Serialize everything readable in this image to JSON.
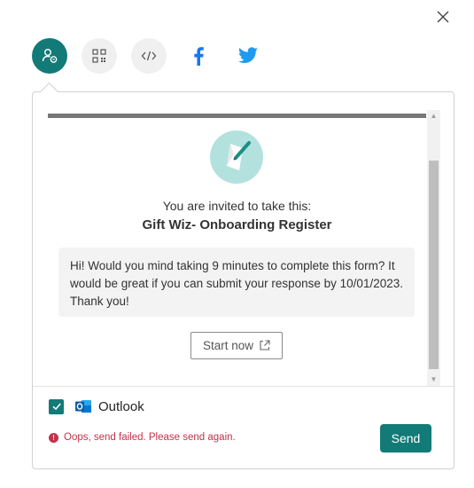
{
  "share": {
    "options": [
      {
        "icon": "person-link-icon"
      },
      {
        "icon": "qr-code-icon"
      },
      {
        "icon": "embed-code-icon"
      },
      {
        "icon": "facebook-icon"
      },
      {
        "icon": "twitter-icon"
      }
    ],
    "close_icon": "close-icon"
  },
  "preview": {
    "invite_text": "You are invited to take this:",
    "form_title": "Gift Wiz- Onboarding Register",
    "message": "Hi! Would you mind taking 9 minutes to complete this form? It would be great if you can submit your response by 10/01/2023. Thank you!",
    "start_label": "Start now"
  },
  "outlook": {
    "label": "Outlook",
    "checked": true
  },
  "error": {
    "text": "Oops, send failed. Please send again."
  },
  "send": {
    "label": "Send"
  },
  "colors": {
    "accent": "#127a77",
    "error": "#c4314b",
    "twitter": "#1d9bf0",
    "facebook": "#1877f2"
  }
}
